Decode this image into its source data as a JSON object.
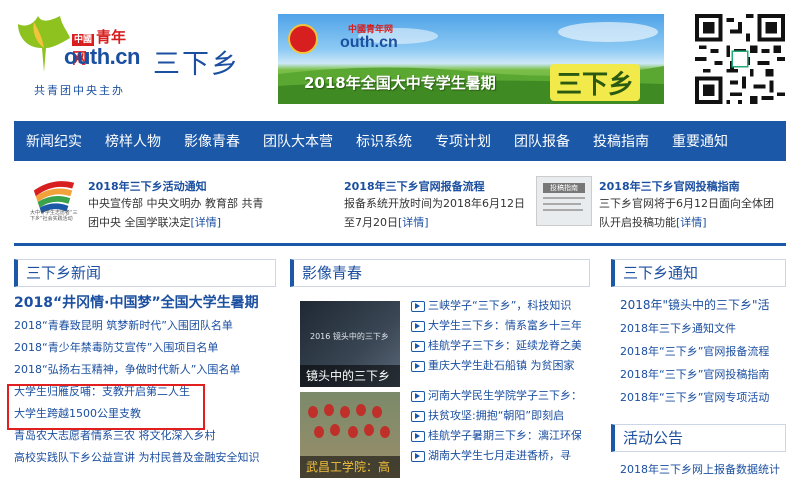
{
  "header": {
    "logo_cn": "青年网",
    "logo_cn_prefix": "中國",
    "logo_youth": "outh.cn",
    "logo_sub": "共青团中央主办",
    "site_title": "三下乡"
  },
  "banner": {
    "logo_cn": "中國青年网",
    "logo_youth": "outh.cn",
    "text": "2018年全国大中专学生暑期",
    "big": "三下乡"
  },
  "nav": [
    "新闻纪实",
    "榜样人物",
    "影像青春",
    "团队大本营",
    "标识系统",
    "专项计划",
    "团队报备",
    "投稿指南",
    "重要通知"
  ],
  "highlights": [
    {
      "title": "2018年三下乡活动通知",
      "line1": "中央宣传部 中央文明办 教育部 共青",
      "line2": "团中央 全国学联决定",
      "more": "[详情]",
      "img_text": "大中专学生志愿者“三下乡”社会实践活动"
    },
    {
      "title": "2018年三下乡官网报备流程",
      "line1": "报备系统开放时间为2018年6月12日",
      "line2": "至7月20日",
      "more": "[详情]"
    },
    {
      "title": "2018年三下乡官网投稿指南",
      "line1": "三下乡官网将于6月12日面向全体团",
      "line2": "队开启投稿功能",
      "more": "[详情]",
      "img_text": "投稿指南"
    }
  ],
  "news": {
    "header": "三下乡新闻",
    "headline": "2018“井冈情·中国梦”全国大学生暑期",
    "items": [
      "2018“青春致昆明 筑梦新时代”入围团队名单",
      "2018“青少年禁毒防艾宣传”入围项目名单",
      "2018“弘扬右玉精神，争做时代新人”入围名单",
      "大学生归雁反哺：支教开启第二人生",
      "大学生跨越1500公里支教",
      "青岛农大志愿者情系三农 将文化深入乡村",
      "高校实践队下乡公益宣讲 为村民普及金融安全知识"
    ]
  },
  "video": {
    "header": "影像青春",
    "img1_caption": "镜头中的三下乡",
    "img1_inner": "2016 镜头中的三下乡",
    "img2_caption": "武昌工学院：高",
    "items": [
      "三峡学子“三下乡”，科技知识",
      "大学生三下乡：情系富乡十三年",
      "桂航学子三下乡：延续龙脊之美",
      "重庆大学生赴石船镇 为贫困家",
      "河南大学民生学院学子三下乡：",
      "扶贫攻坚:拥抱“朝阳”即刻启",
      "桂航学子暑期三下乡：漓江环保",
      "湖南大学生七月走进香桥，寻"
    ]
  },
  "notice": {
    "header": "三下乡通知",
    "items": [
      "2018年\"镜头中的三下乡\"活",
      "2018年三下乡通知文件",
      "2018年“三下乡”官网报备流程",
      "2018年“三下乡”官网投稿指南",
      "2018年“三下乡”官网专项活动"
    ]
  },
  "announcement": {
    "header": "活动公告",
    "items": [
      "2018年三下乡网上报备数据统计"
    ]
  },
  "colors": {
    "brand_blue": "#1b58a8",
    "highlight_red": "#e21f1f"
  }
}
